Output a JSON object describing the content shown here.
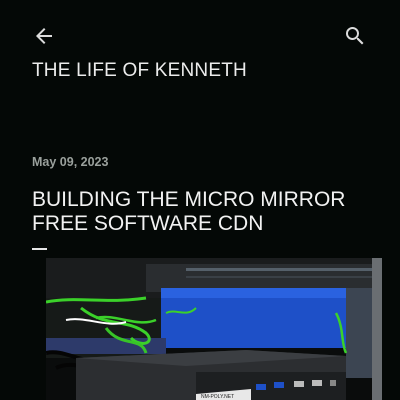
{
  "header": {
    "back_icon": "arrow-left-icon",
    "search_icon": "search-icon",
    "blog_title": "THE LIFE OF KENNETH"
  },
  "post": {
    "date": "May 09, 2023",
    "title": "BUILDING THE MICRO MIRROR FREE SOFTWARE CDN",
    "image_alt": "Mini PC server hardware on a rack shelf with green cables",
    "image_label_text": "NM-POLY.NET"
  },
  "colors": {
    "background": "#040806",
    "text": "#ececec",
    "muted": "#9aa09c",
    "accent_green": "#3bd12a",
    "accent_blue": "#1e50c8"
  }
}
